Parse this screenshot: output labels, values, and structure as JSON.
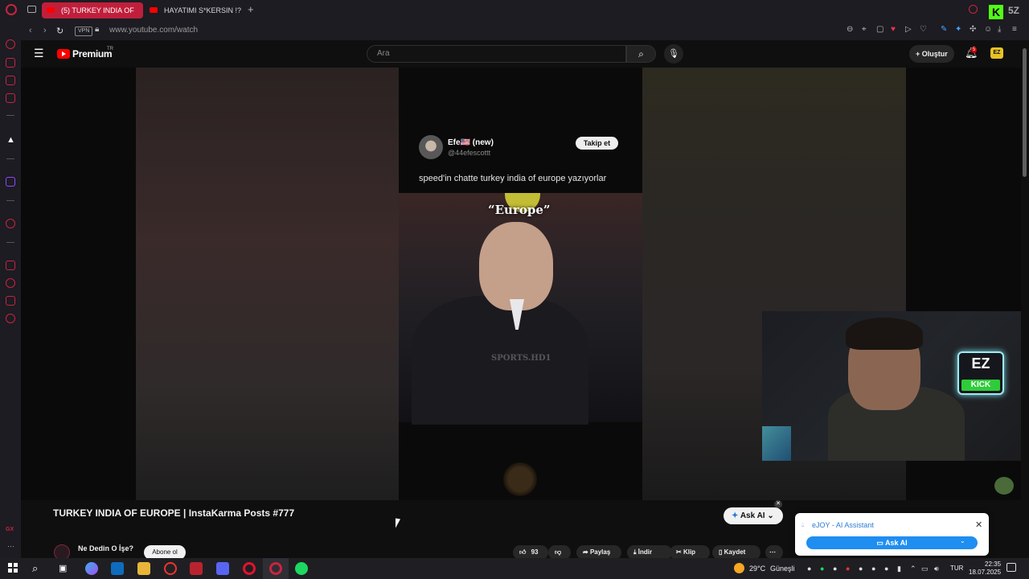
{
  "browser": {
    "tabs": [
      {
        "label": "(5) TURKEY INDIA OF",
        "active": true
      },
      {
        "label": "HAYATIMI S*KERSIN !? | "
      }
    ],
    "new_tab": "+",
    "vpn": "VPN",
    "url": "www.youtube.com/watch",
    "accent_color": "#c01f3c"
  },
  "youtube": {
    "brand": "Premium",
    "brand_region": "TR",
    "search_placeholder": "Ara",
    "create_label": "Oluştur",
    "notification_count": "5",
    "avatar_text": "EZ"
  },
  "video_content": {
    "tweet_name": "Efe🇺🇸 (new)",
    "tweet_handle": "@44efescottt",
    "follow_label": "Takip et",
    "tweet_text": "speed'in chatte turkey india of europe yazıyorlar",
    "caption": "“Europe”",
    "watermark": "SPORTS.HD1",
    "cam_logo_top": "EZ",
    "cam_logo_bottom": "KICK"
  },
  "video_info": {
    "title": "TURKEY INDIA OF EUROPE | InstaKarma Posts #777",
    "channel": "Ne Dedin O İşe?",
    "subscribe_label": "Abone ol",
    "likes": "93",
    "share_label": "Paylaş",
    "download_label": "İndir",
    "clip_label": "Klip",
    "save_label": "Kaydet",
    "more_label": "⋯",
    "ask_ai_label": "Ask AI"
  },
  "ejoy": {
    "title": "eJOY - AI Assistant",
    "button_label": "Ask AI"
  },
  "taskbar": {
    "temperature": "29°C",
    "weather": "Güneşli",
    "language": "TUR",
    "time": "22:35",
    "date": "18.07.2025"
  }
}
